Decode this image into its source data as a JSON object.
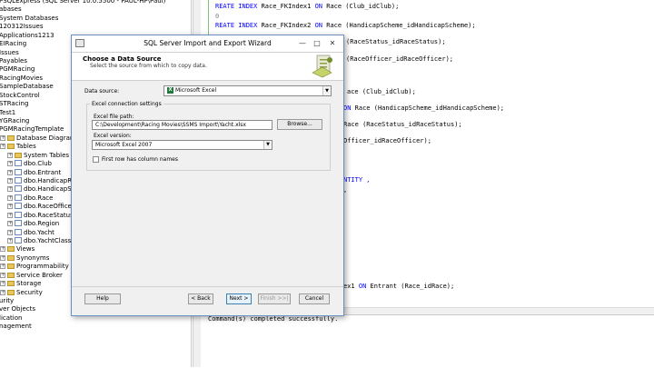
{
  "explorer": {
    "items": [
      {
        "text": "PSQLExpress (SQL Server 10.0.5500 - PAUL-HP\\Paul)",
        "indent": 0,
        "icon": "none"
      },
      {
        "text": "abases",
        "indent": 0,
        "icon": "none"
      },
      {
        "text": "System Databases",
        "indent": 0,
        "icon": "none"
      },
      {
        "text": "120312Issues",
        "indent": 0,
        "icon": "none"
      },
      {
        "text": "Applications1213",
        "indent": 0,
        "icon": "none"
      },
      {
        "text": "EIRacing",
        "indent": 0,
        "icon": "none"
      },
      {
        "text": "Issues",
        "indent": 0,
        "icon": "none"
      },
      {
        "text": "Payables",
        "indent": 0,
        "icon": "none"
      },
      {
        "text": "PGMRacing",
        "indent": 0,
        "icon": "none"
      },
      {
        "text": "RacingMovies",
        "indent": 0,
        "icon": "none"
      },
      {
        "text": "SampleDatabase",
        "indent": 0,
        "icon": "none"
      },
      {
        "text": "StockControl",
        "indent": 0,
        "icon": "none"
      },
      {
        "text": "STRacing",
        "indent": 0,
        "icon": "none"
      },
      {
        "text": "Test1",
        "indent": 0,
        "icon": "none"
      },
      {
        "text": "YGRacing",
        "indent": 0,
        "icon": "none"
      },
      {
        "text": "PGMRacingTemplate",
        "indent": 0,
        "icon": "none"
      },
      {
        "text": "Database Diagrams",
        "indent": 1,
        "icon": "folder"
      },
      {
        "text": "Tables",
        "indent": 1,
        "icon": "folder"
      },
      {
        "text": "System Tables",
        "indent": 2,
        "icon": "folder"
      },
      {
        "text": "dbo.Club",
        "indent": 2,
        "icon": "table"
      },
      {
        "text": "dbo.Entrant",
        "indent": 2,
        "icon": "table"
      },
      {
        "text": "dbo.HandicapRating",
        "indent": 2,
        "icon": "table"
      },
      {
        "text": "dbo.HandicapScheme",
        "indent": 2,
        "icon": "table"
      },
      {
        "text": "dbo.Race",
        "indent": 2,
        "icon": "table"
      },
      {
        "text": "dbo.RaceOfficer",
        "indent": 2,
        "icon": "table"
      },
      {
        "text": "dbo.RaceStatus",
        "indent": 2,
        "icon": "table"
      },
      {
        "text": "dbo.Region",
        "indent": 2,
        "icon": "table"
      },
      {
        "text": "dbo.Yacht",
        "indent": 2,
        "icon": "table"
      },
      {
        "text": "dbo.YachtClass",
        "indent": 2,
        "icon": "table"
      },
      {
        "text": "Views",
        "indent": 1,
        "icon": "folder"
      },
      {
        "text": "Synonyms",
        "indent": 1,
        "icon": "folder"
      },
      {
        "text": "Programmability",
        "indent": 1,
        "icon": "folder"
      },
      {
        "text": "Service Broker",
        "indent": 1,
        "icon": "folder"
      },
      {
        "text": "Storage",
        "indent": 1,
        "icon": "folder"
      },
      {
        "text": "Security",
        "indent": 1,
        "icon": "folder"
      },
      {
        "text": "urity",
        "indent": 0,
        "icon": "none"
      },
      {
        "text": "ver Objects",
        "indent": 0,
        "icon": "none"
      },
      {
        "text": "lication",
        "indent": 0,
        "icon": "none"
      },
      {
        "text": "nagement",
        "indent": 0,
        "icon": "none"
      }
    ]
  },
  "code": {
    "line1_kw1": "REATE INDEX",
    "line1_rest": " Race_FKIndex1 ",
    "line1_kw2": "ON",
    "line1_end": " Race (Club_idClub);",
    "line2": "0",
    "line3_kw1": "REATE INDEX",
    "line3_rest": " Race_FKIndex2 ",
    "line3_kw2": "ON",
    "line3_end": " Race (HandicapScheme_idHandicapScheme);",
    "line4": "(RaceStatus_idRaceStatus);",
    "line5": "(RaceOfficer_idRaceOfficer);",
    "line6": "ace (Club_idClub);",
    "line7_kw": "ON",
    "line7_end": " Race (HandicapScheme_idHandicapScheme);",
    "line8": "Race (RaceStatus_idRaceStatus);",
    "line9": "Officer_idRaceOfficer);",
    "line10": "NTITY ,",
    "line11": ",",
    "line12_a": "ex1 ",
    "line12_kw": "ON",
    "line12_b": " Entrant (Race_idRace);"
  },
  "results": {
    "message": "Command(s) completed successfully."
  },
  "dialog": {
    "title": "SQL Server Import and Export Wizard",
    "minimize": "—",
    "maximize": "□",
    "close": "✕",
    "header_title": "Choose a Data Source",
    "header_subtitle": "Select the source from which to copy data.",
    "data_source_label": "Data source:",
    "data_source_value": "Microsoft Excel",
    "group_label": "Excel connection settings",
    "file_path_label": "Excel file path:",
    "file_path_value": "C:\\Development\\Racing Movies\\SSMS Import\\Yacht.xlsx",
    "browse_label": "Browse...",
    "version_label": "Excel version:",
    "version_value": "Microsoft Excel 2007",
    "first_row_label": "First row has column names",
    "first_row_checked": false,
    "help_label": "Help",
    "back_label": "< Back",
    "next_label": "Next >",
    "finish_label": "Finish >>|",
    "cancel_label": "Cancel"
  }
}
